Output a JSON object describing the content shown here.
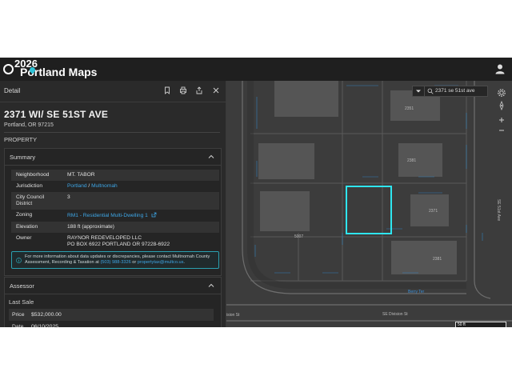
{
  "app": {
    "brand": "Portland Maps",
    "year_badge": "2026"
  },
  "panel": {
    "title": "Detail",
    "address": "2371 WI/ SE 51ST AVE",
    "city": "Portland, OR 97215",
    "property_label": "PROPERTY"
  },
  "summary": {
    "heading": "Summary",
    "rows": [
      {
        "key": "Neighborhood",
        "value": "MT. TABOR"
      },
      {
        "key": "Jurisdiction",
        "value_a": "Portland",
        "value_sep": " / ",
        "value_b": "Multnomah"
      },
      {
        "key": "City Council District",
        "value": "3"
      },
      {
        "key": "Zoning",
        "value": "RM1 - Residential Multi-Dwelling 1"
      },
      {
        "key": "Elevation",
        "value": "188 ft (approximate)"
      },
      {
        "key": "Owner",
        "value_line1": "RAYNOR REDEVELOPED LLC",
        "value_line2": "PO BOX 6922 PORTLAND OR 97228-6922"
      }
    ],
    "info_text": "For more information about data updates or discrepancies, please contact Multnomah County Assessment, Recording & Taxation at",
    "info_phone": "(503) 988-3326",
    "info_or": " or ",
    "info_email": "propertytax@multco.us",
    "info_end": "."
  },
  "assessor": {
    "heading": "Assessor",
    "last_sale_label": "Last Sale",
    "price_key": "Price",
    "price_value": "$532,000.00",
    "date_key": "Date",
    "date_value": "06/10/2025"
  },
  "map": {
    "search_value": "2371 se 51st ave",
    "street_bottom": "SE Division St",
    "street_bottom_left": "ision St",
    "street_right": "SE 51st Ave",
    "street_curve": "Berry Ter",
    "scale_label": "50 ft",
    "parcel_labels": {
      "p1": "2351",
      "p2": "2381",
      "p3": "2371",
      "p4": "5007",
      "p5": "2381"
    },
    "highlight_color": "#2ee6f0",
    "lot_line_color": "#2f8fd8"
  }
}
